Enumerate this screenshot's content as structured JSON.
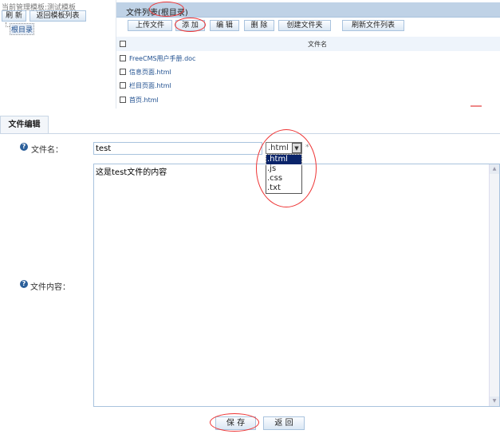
{
  "sidebar": {
    "current_template": "当前管理模板:测试模板",
    "refresh": "刷 新",
    "back_to_list": "返回模板列表",
    "tree_root": "根目录"
  },
  "file_panel": {
    "title": "文件列表(根目录)",
    "buttons": {
      "upload": "上传文件",
      "add": "添 加",
      "edit": "编 辑",
      "delete": "删 除",
      "new_folder": "创建文件夹",
      "refresh_list": "刷新文件列表"
    },
    "column_header": "文件名",
    "files": [
      "FreeCMS用户手册.doc",
      "信息页面.html",
      "栏目页面.html",
      "首页.html"
    ]
  },
  "editor": {
    "tab": "文件编辑",
    "filename_label": "文件名：",
    "filename_value": "test",
    "extension_selected": ".html",
    "extension_options": [
      ".html",
      ".js",
      ".css",
      ".txt"
    ],
    "required_mark": "*",
    "content_label": "文件内容：",
    "content_value": "这是test文件的内容",
    "save": "保 存",
    "back": "返 回"
  }
}
